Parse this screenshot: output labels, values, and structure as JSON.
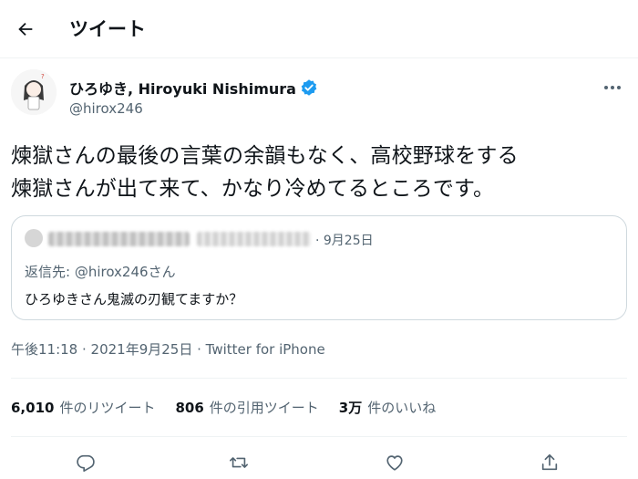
{
  "header": {
    "title": "ツイート",
    "back_icon": "arrow-left-icon"
  },
  "author": {
    "display_name": "ひろゆき, Hiroyuki Nishimura",
    "handle": "@hirox246",
    "verified": true,
    "more_icon": "more-icon"
  },
  "tweet": {
    "text_line1": "煉獄さんの最後の言葉の余韻もなく、高校野球をする",
    "text_line2": "煉獄さんが出て来て、かなり冷めてるところです。"
  },
  "quote": {
    "date": "· 9月25日",
    "reply_prefix": "返信先: ",
    "reply_to": "@hirox246さん",
    "text": "ひろゆきさん鬼滅の刃観てますか？"
  },
  "meta": {
    "time": "午後11:18 · 2021年9月25日 · ",
    "client": "Twitter for iPhone"
  },
  "stats": [
    {
      "num": "6,010",
      "label": "件のリツイート"
    },
    {
      "num": "806",
      "label": "件の引用ツイート"
    },
    {
      "num": "3万",
      "label": "件のいいね"
    }
  ],
  "actions": [
    "reply-icon",
    "retweet-icon",
    "like-icon",
    "share-icon"
  ],
  "colors": {
    "text": "#0f1419",
    "secondary": "#536471",
    "verified": "#1d9bf0",
    "border": "#cfd9de"
  }
}
